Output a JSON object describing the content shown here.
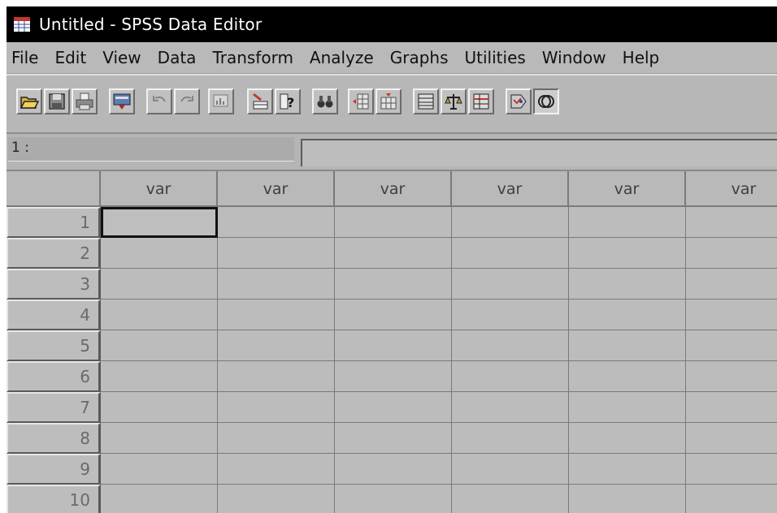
{
  "window": {
    "title": "Untitled - SPSS Data Editor"
  },
  "menu": [
    "File",
    "Edit",
    "View",
    "Data",
    "Transform",
    "Analyze",
    "Graphs",
    "Utilities",
    "Window",
    "Help"
  ],
  "toolbar": {
    "buttons": [
      {
        "name": "open-file-button",
        "icon": "open-folder-icon"
      },
      {
        "name": "save-file-button",
        "icon": "floppy-disk-icon"
      },
      {
        "name": "print-button",
        "icon": "printer-icon"
      },
      {
        "name": "dialog-recall-button",
        "icon": "dialog-recall-icon"
      },
      {
        "name": "undo-button",
        "icon": "undo-icon"
      },
      {
        "name": "redo-button",
        "icon": "redo-icon"
      },
      {
        "name": "goto-chart-button",
        "icon": "chart-icon"
      },
      {
        "name": "goto-case-button",
        "icon": "goto-case-icon"
      },
      {
        "name": "variables-button",
        "icon": "variable-info-icon"
      },
      {
        "name": "find-button",
        "icon": "binoculars-icon"
      },
      {
        "name": "insert-case-button",
        "icon": "insert-case-icon"
      },
      {
        "name": "insert-variable-button",
        "icon": "insert-variable-icon"
      },
      {
        "name": "split-file-button",
        "icon": "split-file-icon"
      },
      {
        "name": "weight-cases-button",
        "icon": "scale-icon"
      },
      {
        "name": "select-cases-button",
        "icon": "select-cases-icon"
      },
      {
        "name": "value-labels-button",
        "icon": "value-labels-icon"
      },
      {
        "name": "use-sets-button",
        "icon": "use-sets-icon"
      }
    ]
  },
  "cell_editor": {
    "reference": "1 :",
    "value": ""
  },
  "grid": {
    "columns": [
      "var",
      "var",
      "var",
      "var",
      "var",
      "var"
    ],
    "rows": [
      "1",
      "2",
      "3",
      "4",
      "5",
      "6",
      "7",
      "8",
      "9",
      "10"
    ],
    "active_cell": {
      "row": 1,
      "column": 1
    }
  }
}
